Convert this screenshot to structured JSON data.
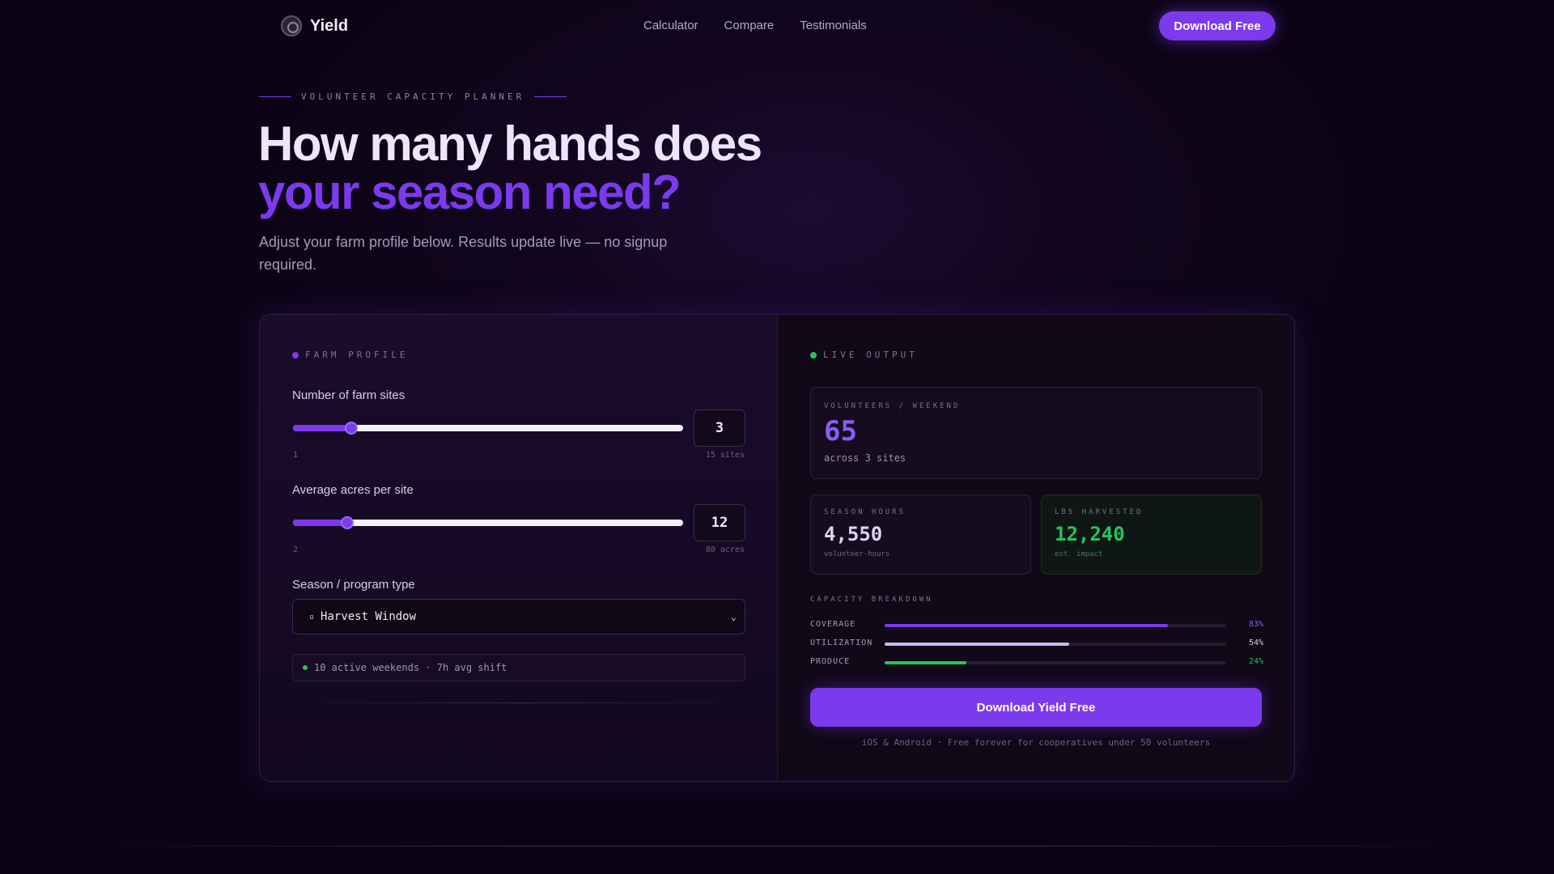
{
  "nav": {
    "brand": "Yield",
    "links": [
      "Calculator",
      "Compare",
      "Testimonials"
    ],
    "cta": "Download Free"
  },
  "hero": {
    "eyebrow": "VOLUNTEER CAPACITY PLANNER",
    "title_line1": "How many hands does",
    "title_line2": "your season need?",
    "subtitle": "Adjust your farm profile below. Results update live — no signup required."
  },
  "profile": {
    "section_label": "FARM PROFILE",
    "sites": {
      "label": "Number of farm sites",
      "value": "3",
      "min_label": "1",
      "max_label": "15 sites",
      "fraction": 0.15
    },
    "acres": {
      "label": "Average acres per site",
      "value": "12",
      "min_label": "2",
      "max_label": "80 acres",
      "fraction": 0.14
    },
    "season": {
      "label": "Season / program type",
      "selected": "Harvest Window",
      "icon": "▫"
    },
    "info": "10 active weekends · 7h avg shift"
  },
  "output": {
    "section_label": "LIVE OUTPUT",
    "volunteers": {
      "label": "VOLUNTEERS / WEEKEND",
      "value": "65",
      "sub": "across 3 sites"
    },
    "hours": {
      "label": "SEASON HOURS",
      "value": "4,550",
      "sub": "volunteer-hours"
    },
    "lbs": {
      "label": "LBS HARVESTED",
      "value": "12,240",
      "sub": "est. impact"
    },
    "breakdown_label": "CAPACITY BREAKDOWN",
    "breakdown": [
      {
        "name": "COVERAGE",
        "pct": "83%",
        "fraction": 0.83,
        "color": "#7c3aed",
        "pct_color": "#8b5cf6"
      },
      {
        "name": "UTILIZATION",
        "pct": "54%",
        "fraction": 0.54,
        "color": "#c9b8f0",
        "pct_color": "#d7cfe6"
      },
      {
        "name": "PRODUCE",
        "pct": "24%",
        "fraction": 0.24,
        "color": "#22c55e",
        "pct_color": "#22c55e"
      }
    ],
    "cta": "Download Yield Free",
    "cta_note": "iOS & Android · Free forever for cooperatives under 50 volunteers"
  },
  "colors": {
    "accent": "#7c3aed",
    "success": "#22c55e"
  }
}
